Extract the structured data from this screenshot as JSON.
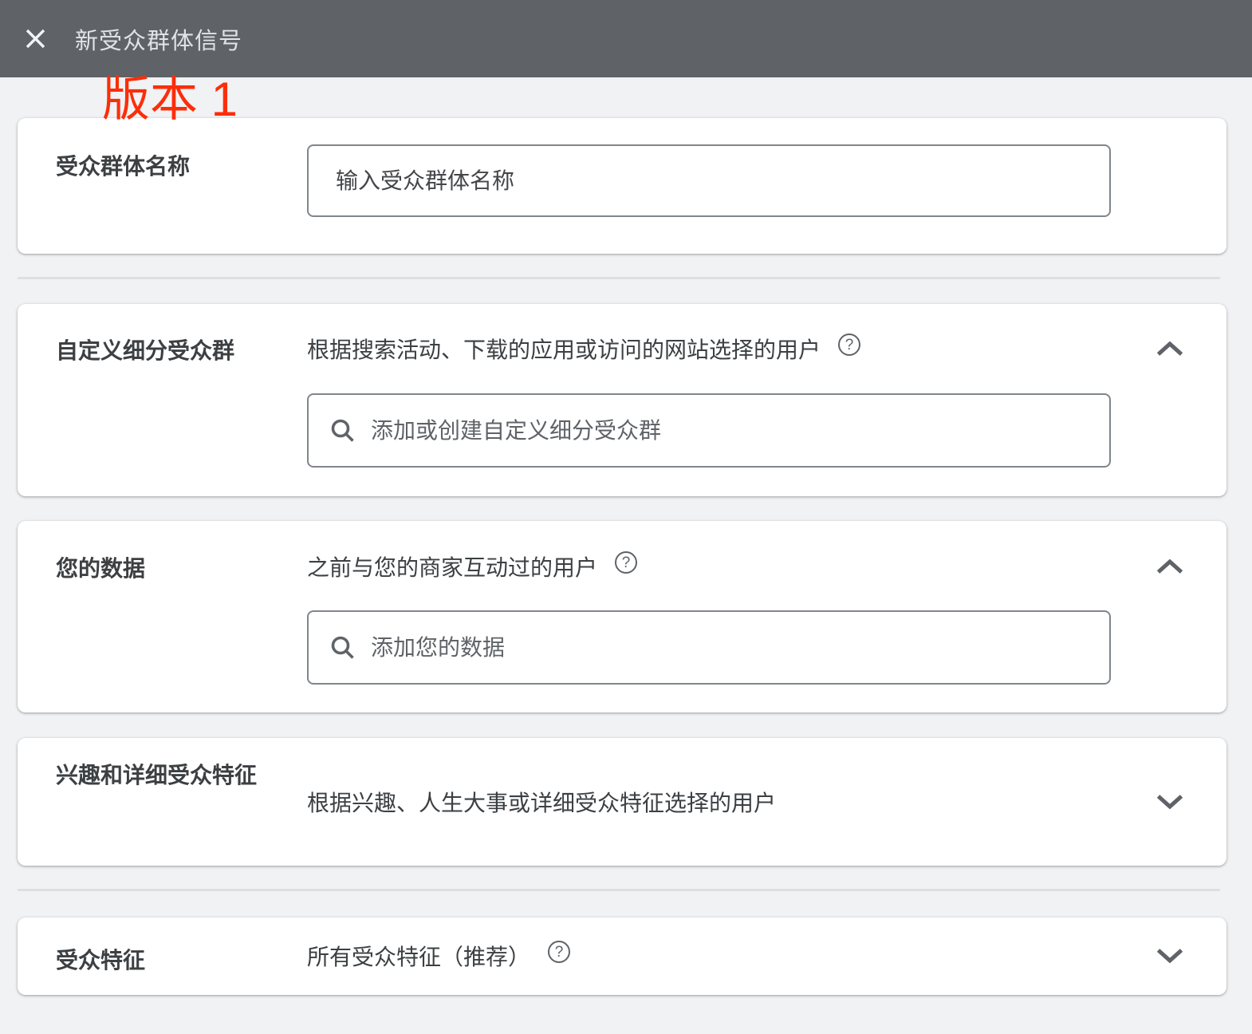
{
  "header": {
    "title": "新受众群体信号"
  },
  "annotation": {
    "text": "版本 1"
  },
  "icons": {
    "help_glyph": "?"
  },
  "colors": {
    "header_bg": "#5f6368",
    "page_bg": "#f1f2f4",
    "card_bg": "#ffffff",
    "annotation_red": "#fb2e0a",
    "text_primary": "#3c4043",
    "text_secondary": "#5f6368",
    "input_border": "#80868b",
    "divider": "#dde0e3"
  },
  "sections": {
    "audience_name": {
      "label": "受众群体名称",
      "placeholder": "输入受众群体名称"
    },
    "custom_segments": {
      "label": "自定义细分受众群",
      "description": "根据搜索活动、下载的应用或访问的网站选择的用户",
      "search_placeholder": "添加或创建自定义细分受众群",
      "state": "expanded"
    },
    "your_data": {
      "label": "您的数据",
      "description": "之前与您的商家互动过的用户",
      "search_placeholder": "添加您的数据",
      "state": "expanded"
    },
    "interests": {
      "label": "兴趣和详细受众特征",
      "description": "根据兴趣、人生大事或详细受众特征选择的用户",
      "state": "collapsed"
    },
    "demographics": {
      "label": "受众特征",
      "description": "所有受众特征（推荐）",
      "state": "collapsed"
    }
  }
}
